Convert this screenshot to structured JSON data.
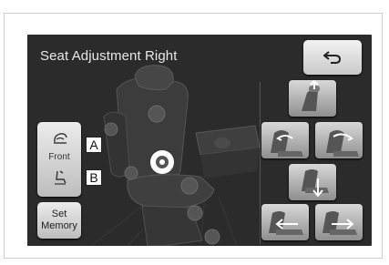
{
  "screen": {
    "title": "Seat Adjustment Right",
    "back_icon": "return-arrow-icon"
  },
  "side_buttons": {
    "front_label": "Front",
    "set_memory_line1": "Set",
    "set_memory_line2": "Memory"
  },
  "callouts": {
    "a": "A",
    "b": "B"
  },
  "adjust_buttons": [
    {
      "icon": "headrest-up-icon"
    },
    {
      "icon": "seatback-recline-forward-icon"
    },
    {
      "icon": "seatback-recline-back-icon"
    },
    {
      "icon": "seat-lift-down-icon"
    },
    {
      "icon": "seat-slide-forward-icon"
    },
    {
      "icon": "seat-slide-back-icon"
    }
  ]
}
